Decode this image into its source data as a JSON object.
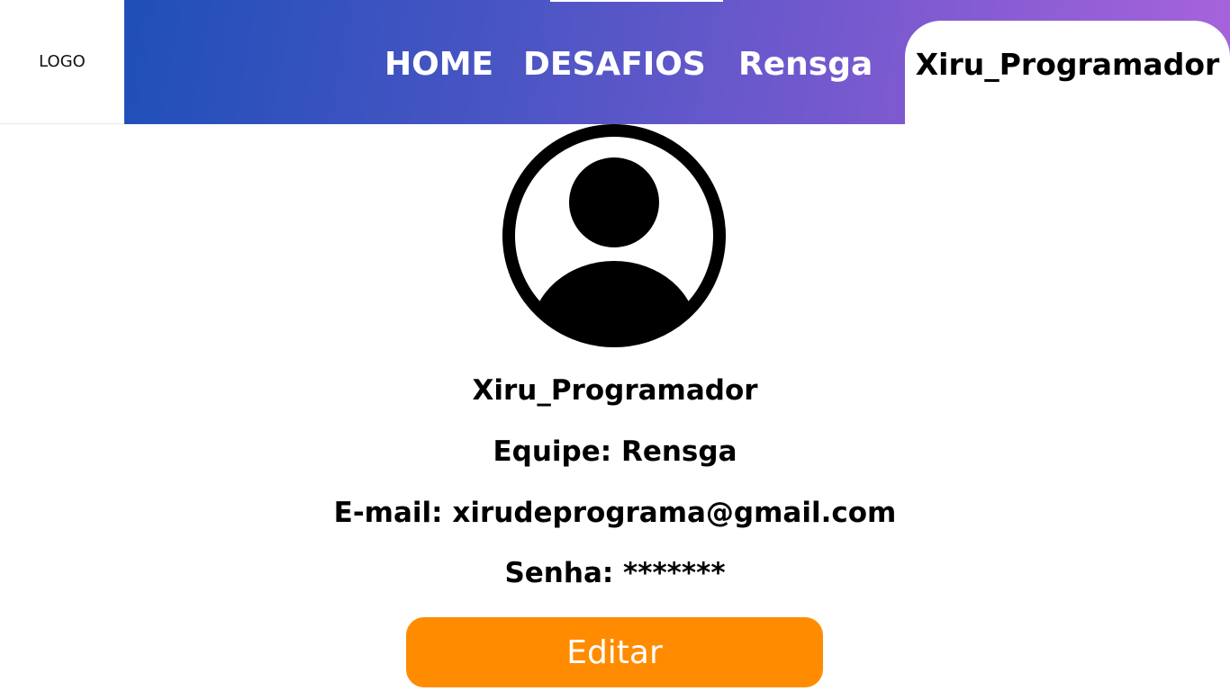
{
  "header": {
    "logo": "LOGO",
    "nav": {
      "home": "HOME",
      "desafios": "DESAFIOS",
      "team": "Rensga"
    },
    "user_tab": "Xiru_Programador",
    "gradient_colors": [
      "#1f4fb8",
      "#a863dc"
    ]
  },
  "profile": {
    "avatar_icon": "user-circle-icon",
    "username": "Xiru_Programador",
    "team_line": "Equipe: Rensga",
    "email_line": "E-mail: xirudeprograma@gmail.com",
    "password_line": "Senha: *******"
  },
  "actions": {
    "edit_label": "Editar",
    "edit_color": "#ff8c00"
  }
}
